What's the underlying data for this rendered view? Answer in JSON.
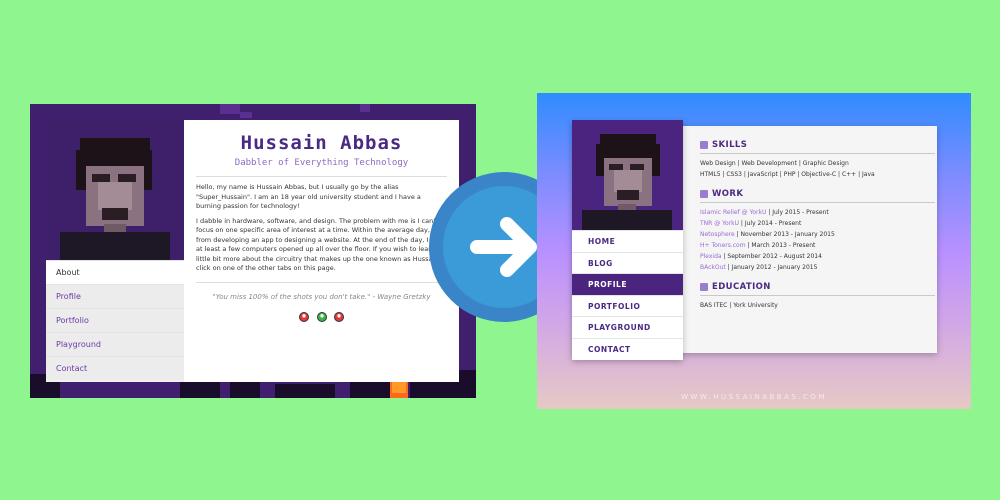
{
  "old_site": {
    "name": "Hussain Abbas",
    "tagline": "Dabbler of Everything Technology",
    "nav": [
      "About",
      "Profile",
      "Portfolio",
      "Playground",
      "Contact"
    ],
    "paragraph1": "Hello, my name is Hussain Abbas, but I usually go by the alias \"Super_Hussain\". I am an 18 year old university student and I have a burning passion for technology!",
    "paragraph2": "I dabble in hardware, software, and design. The problem with me is I can't focus on one specific area of interest at a time. Within the average day, I go from developing an app to designing a website. At the end of the day, I have at least a few computers opened up all over the floor. If you wish to learn a little bit more about the circuitry that makes up the one known as Hussain, click on one of the other tabs on this page.",
    "quote": "\"You miss 100% of the shots you don't take.\" - Wayne Gretzky"
  },
  "new_site": {
    "nav": [
      "HOME",
      "BLOG",
      "PROFILE",
      "PORTFOLIO",
      "PLAYGROUND",
      "CONTACT"
    ],
    "active_nav": "PROFILE",
    "skills": {
      "title": "SKILLS",
      "line1": "Web Design | Web Development | Graphic Design",
      "line2": "HTML5 | CSS3 | JavaScript | PHP | Objective-C | C++ | Java"
    },
    "work": {
      "title": "WORK",
      "items": [
        {
          "org": "Islamic Relief @ YorkU",
          "dates": " | July 2015 - Present"
        },
        {
          "org": "TNR @ YorkU",
          "dates": " | July 2014 - Present"
        },
        {
          "org": "Netosphere",
          "dates": " | November 2013 - January 2015"
        },
        {
          "org": "H+ Toners.com",
          "dates": " | March 2013 - Present"
        },
        {
          "org": "Plexida",
          "dates": " | September 2012 - August 2014"
        },
        {
          "org": "BAckOut",
          "dates": " | January 2012 - January 2015"
        }
      ]
    },
    "education": {
      "title": "EDUCATION",
      "line": "BAS ITEC | York University"
    },
    "footer": "WWW.HUSSAINABBAS.COM"
  },
  "colors": {
    "background": "#8ef58f",
    "brand_purple": "#4b2a83",
    "arrow_blue": "#3a9bd8"
  },
  "icons": {
    "arrow": "arrow-right-icon",
    "skills": "tag-icon",
    "work": "briefcase-icon",
    "education": "document-icon"
  }
}
